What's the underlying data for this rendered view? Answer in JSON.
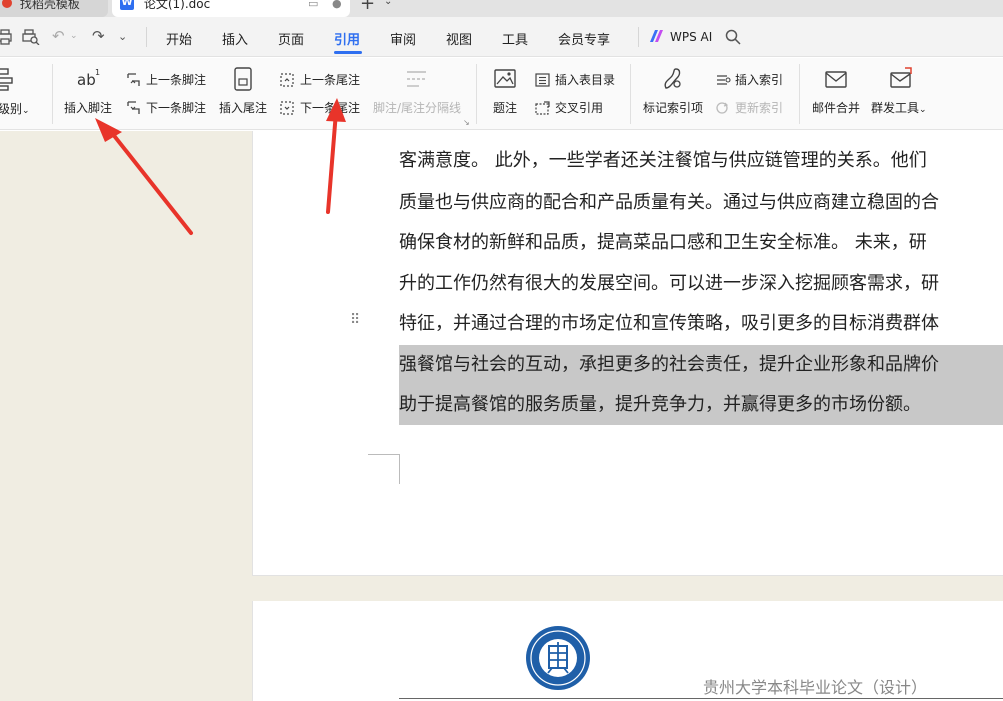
{
  "tabs": {
    "inactive_label": "找稻壳模板",
    "active_label": "论文(1).doc",
    "new_tab_symbol": "+",
    "new_tab_menu_symbol": "⌄"
  },
  "menu": {
    "items": [
      "开始",
      "插入",
      "页面",
      "引用",
      "审阅",
      "视图",
      "工具",
      "会员专享"
    ],
    "active": "引用",
    "wps_ai": "WPS AI"
  },
  "ribbon": {
    "left_cut_label": "级别",
    "insert_footnote": "插入脚注",
    "prev_footnote": "上一条脚注",
    "next_footnote": "下一条脚注",
    "insert_endnote": "插入尾注",
    "prev_endnote": "上一条尾注",
    "next_endnote": "下一条尾注",
    "footnote_separator": "脚注/尾注分隔线",
    "caption": "题注",
    "insert_table_of_figures": "插入表目录",
    "cross_reference": "交叉引用",
    "mark_index_entry": "标记索引项",
    "insert_index": "插入索引",
    "update_index": "更新索引",
    "mail_merge": "邮件合并",
    "group_send_tools": "群发工具"
  },
  "document": {
    "lines": [
      "客满意度。 此外，一些学者还关注餐馆与供应链管理的关系。他们",
      "质量也与供应商的配合和产品质量有关。通过与供应商建立稳固的合",
      "确保食材的新鲜和品质，提高菜品口感和卫生安全标准。 未来，研",
      "升的工作仍然有很大的发展空间。可以进一步深入挖掘顾客需求，研",
      "特征，并通过合理的市场定位和宣传策略，吸引更多的目标消费群体",
      "强餐馆与社会的互动，承担更多的社会责任，提升企业形象和品牌价",
      "助于提高餐馆的服务质量，提升竞争力，并赢得更多的市场份额。"
    ],
    "selected_line_indices": [
      5,
      6
    ],
    "page2_header": "贵州大学本科毕业论文（设计）"
  },
  "colors": {
    "accent": "#2f6ff0",
    "selection": "#c8c8c8",
    "canvas": "#f0ede2",
    "annotation_arrow": "#e8342a"
  }
}
